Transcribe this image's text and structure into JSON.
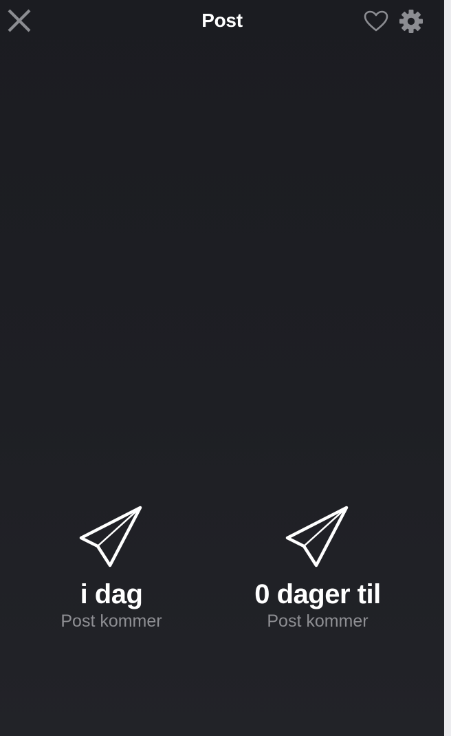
{
  "header": {
    "title": "Post",
    "close_icon": "close-icon",
    "favorite_icon": "heart-outline-icon",
    "settings_icon": "gear-icon"
  },
  "stats": [
    {
      "value": "i dag",
      "label": "Post kommer",
      "icon": "paper-plane-icon"
    },
    {
      "value": "0 dager til",
      "label": "Post kommer",
      "icon": "paper-plane-icon"
    }
  ],
  "colors": {
    "background": "#1e1f24",
    "primary_text": "#ffffff",
    "secondary_text": "#8e8f93",
    "icon_muted": "#8c8d92"
  }
}
